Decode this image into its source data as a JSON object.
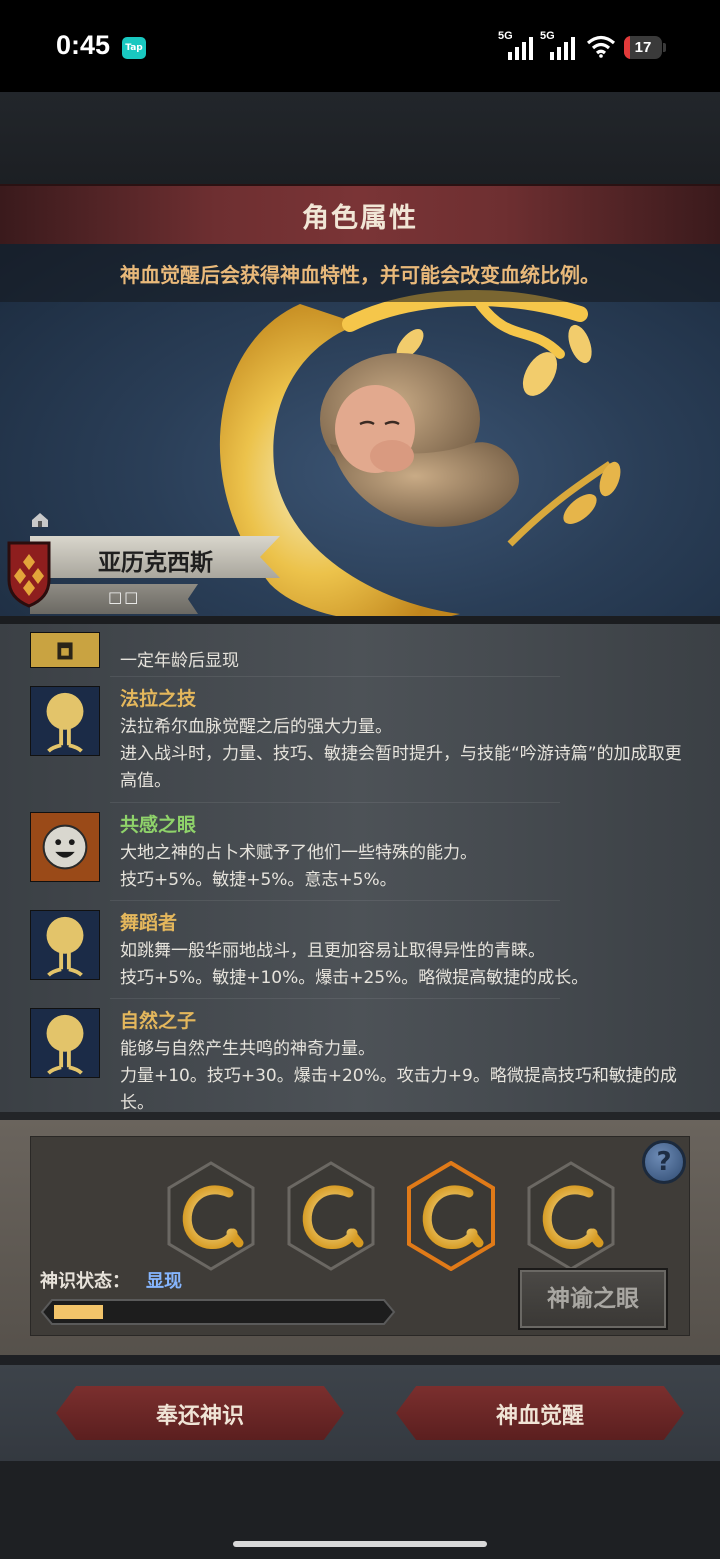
{
  "status_bar": {
    "time": "0:45",
    "app_badge": "Tap",
    "network1": "5G",
    "network2": "5G",
    "battery": "17",
    "battery_level": 0.17
  },
  "header": {
    "title": "角色属性",
    "subtitle": "神血觉醒后会获得神血特性，并可能会改变血统比例。"
  },
  "character": {
    "name": "亚历克西斯",
    "sub_label": "□□"
  },
  "traits": [
    {
      "icon": "lock-icon",
      "name": "",
      "desc": "一定年龄后显现"
    },
    {
      "icon": "tree-icon",
      "name": "法拉之技",
      "desc": "法拉希尔血脉觉醒之后的强大力量。\n进入战斗时，力量、技巧、敏捷会暂时提升，与技能“吟游诗篇”的加成取更高值。"
    },
    {
      "icon": "smile-face-icon",
      "name": "共感之眼",
      "desc": "大地之神的占卜术赋予了他们一些特殊的能力。\n技巧+5%。敏捷+5%。意志+5%。"
    },
    {
      "icon": "tree-icon",
      "name": "舞蹈者",
      "desc": "如跳舞一般华丽地战斗，且更加容易让取得异性的青睐。\n技巧+5%。敏捷+10%。爆击+25%。略微提高敏捷的成长。"
    },
    {
      "icon": "tree-icon",
      "name": "自然之子",
      "desc": "能够与自然产生共鸣的神奇力量。\n力量+10。技巧+30。爆击+20%。攻击力+9。略微提高技巧和敏捷的成长。"
    }
  ],
  "trait_colors": {
    "normal": "#e4b75c",
    "highlight": "#8fd36a"
  },
  "divine": {
    "slots": [
      {
        "icon": "golden-dragon-icon",
        "selected": false
      },
      {
        "icon": "golden-dragon-icon",
        "selected": false
      },
      {
        "icon": "golden-dragon-icon",
        "selected": true
      },
      {
        "icon": "golden-dragon-icon",
        "selected": false
      }
    ],
    "help_label": "?",
    "status_label": "神识状态：",
    "status_value": "显现",
    "progress": 0.15,
    "oracle_button": "神谕之眼"
  },
  "footer": {
    "return_button": "奉还神识",
    "awaken_button": "神血觉醒"
  },
  "colors": {
    "accent_red": "#7b2f2e",
    "title_gold": "#e9b97a",
    "status_blue": "#86b6ff",
    "progress_fill": "#f2c46a"
  }
}
